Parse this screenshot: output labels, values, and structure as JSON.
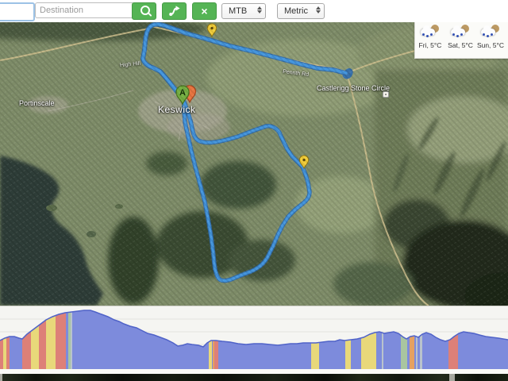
{
  "toolbar": {
    "origin_value": "",
    "destination_placeholder": "Destination",
    "clear_glyph": "×",
    "route_type": "MTB",
    "units": "Metric"
  },
  "weather": {
    "days": [
      {
        "label": "Fri, 5°C"
      },
      {
        "label": "Sat, 5°C"
      },
      {
        "label": "Sun, 5°C"
      }
    ]
  },
  "map": {
    "labels": {
      "town": "Keswick",
      "village": "Portinscale",
      "poi": "Castlerigg Stone Circle",
      "road_east": "Penrith Rd",
      "road_north": "High Hill"
    },
    "markers": {
      "start_label": "A",
      "start_color": "#76b043",
      "alt_color": "#e8743f",
      "warning_color": "#f2ce3a"
    },
    "route_color": "#4596dd"
  },
  "elevation": {
    "area_color": "#7d8bdc",
    "line_color": "#5063c8",
    "band_colors": {
      "steep": "#dd8078",
      "moderate": "#e8d87a",
      "mild": "#e5a161",
      "offroad": "#a9c5a0",
      "path": "#b9c3cc"
    },
    "height": 80,
    "points": [
      [
        0,
        43
      ],
      [
        6,
        40
      ],
      [
        12,
        38
      ],
      [
        18,
        38
      ],
      [
        24,
        40
      ],
      [
        28,
        41
      ],
      [
        34,
        35
      ],
      [
        42,
        29
      ],
      [
        50,
        23
      ],
      [
        58,
        17
      ],
      [
        66,
        13
      ],
      [
        74,
        10
      ],
      [
        82,
        8
      ],
      [
        90,
        7
      ],
      [
        98,
        6
      ],
      [
        106,
        5
      ],
      [
        114,
        5
      ],
      [
        120,
        7
      ],
      [
        128,
        10
      ],
      [
        136,
        13
      ],
      [
        144,
        17
      ],
      [
        150,
        19
      ],
      [
        156,
        22
      ],
      [
        164,
        25
      ],
      [
        172,
        27
      ],
      [
        178,
        30
      ],
      [
        186,
        34
      ],
      [
        194,
        36
      ],
      [
        202,
        39
      ],
      [
        210,
        42
      ],
      [
        218,
        46
      ],
      [
        224,
        50
      ],
      [
        230,
        49
      ],
      [
        236,
        47
      ],
      [
        242,
        48
      ],
      [
        250,
        49
      ],
      [
        256,
        51
      ],
      [
        261,
        46
      ],
      [
        266,
        43
      ],
      [
        272,
        43
      ],
      [
        280,
        44
      ],
      [
        290,
        45
      ],
      [
        300,
        47
      ],
      [
        310,
        48
      ],
      [
        320,
        47
      ],
      [
        330,
        47
      ],
      [
        340,
        48
      ],
      [
        350,
        49
      ],
      [
        358,
        48
      ],
      [
        366,
        47
      ],
      [
        374,
        47
      ],
      [
        382,
        46
      ],
      [
        390,
        46
      ],
      [
        398,
        46
      ],
      [
        406,
        45
      ],
      [
        414,
        44
      ],
      [
        422,
        44
      ],
      [
        428,
        42
      ],
      [
        434,
        43
      ],
      [
        442,
        42
      ],
      [
        450,
        41
      ],
      [
        458,
        39
      ],
      [
        466,
        35
      ],
      [
        472,
        33
      ],
      [
        478,
        32
      ],
      [
        484,
        34
      ],
      [
        490,
        33
      ],
      [
        496,
        32
      ],
      [
        502,
        34
      ],
      [
        507,
        38
      ],
      [
        512,
        41
      ],
      [
        517,
        38
      ],
      [
        522,
        37
      ],
      [
        527,
        39
      ],
      [
        532,
        35
      ],
      [
        537,
        33
      ],
      [
        543,
        35
      ],
      [
        549,
        39
      ],
      [
        555,
        42
      ],
      [
        561,
        44
      ],
      [
        567,
        42
      ],
      [
        572,
        38
      ],
      [
        578,
        34
      ],
      [
        584,
        32
      ],
      [
        590,
        33
      ],
      [
        597,
        34
      ],
      [
        604,
        36
      ],
      [
        612,
        38
      ],
      [
        620,
        39
      ],
      [
        628,
        40
      ],
      [
        634,
        41
      ],
      [
        640,
        42
      ]
    ],
    "bands": [
      [
        0,
        4,
        "steep"
      ],
      [
        4,
        4,
        "moderate"
      ],
      [
        8,
        4,
        "steep"
      ],
      [
        28,
        11,
        "steep"
      ],
      [
        39,
        10,
        "moderate"
      ],
      [
        49,
        9,
        "steep"
      ],
      [
        58,
        12,
        "moderate"
      ],
      [
        70,
        13,
        "steep"
      ],
      [
        86,
        3,
        "offroad"
      ],
      [
        89,
        2,
        "path"
      ],
      [
        263,
        4,
        "moderate"
      ],
      [
        268,
        2,
        "mild"
      ],
      [
        270,
        5,
        "steep"
      ],
      [
        392,
        10,
        "moderate"
      ],
      [
        435,
        7,
        "moderate"
      ],
      [
        455,
        19,
        "moderate"
      ],
      [
        481,
        2,
        "path"
      ],
      [
        505,
        8,
        "offroad"
      ],
      [
        516,
        6,
        "mild"
      ],
      [
        524,
        2,
        "path"
      ],
      [
        529,
        3,
        "path"
      ],
      [
        565,
        12,
        "steep"
      ]
    ]
  }
}
